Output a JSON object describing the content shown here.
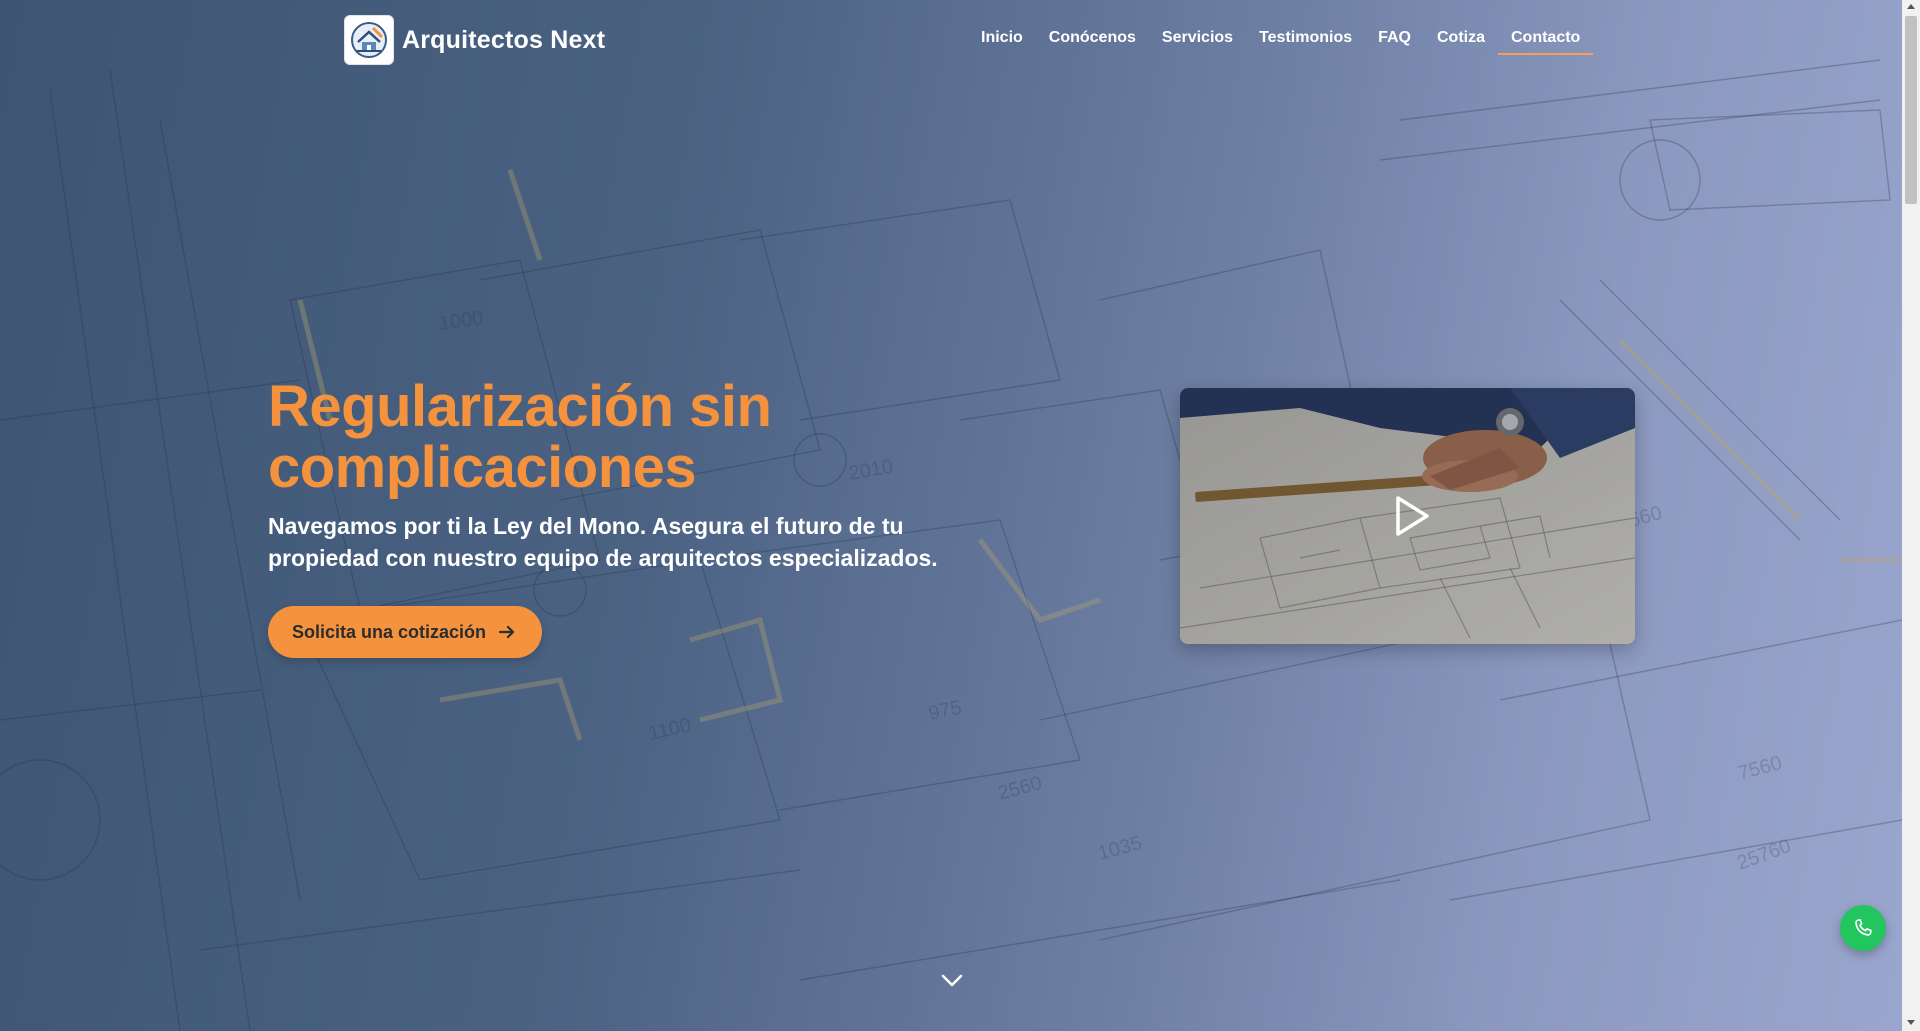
{
  "brand": {
    "name": "Arquitectos Next",
    "logo_icon": "architect-house-drawing-icon"
  },
  "nav": {
    "items": [
      {
        "label": "Inicio",
        "active": false
      },
      {
        "label": "Conócenos",
        "active": false
      },
      {
        "label": "Servicios",
        "active": false
      },
      {
        "label": "Testimonios",
        "active": false
      },
      {
        "label": "FAQ",
        "active": false
      },
      {
        "label": "Cotiza",
        "active": false
      },
      {
        "label": "Contacto",
        "active": true
      }
    ]
  },
  "hero": {
    "title": "Regularización sin complicaciones",
    "subtitle": "Navegamos por ti la Ley del Mono. Asegura el futuro de tu propiedad con nuestro equipo de arquitectos especializados.",
    "cta_label": "Solicita una cotización",
    "cta_icon": "arrow-right-icon"
  },
  "video": {
    "thumbnail": "hands-drawing-blueprint",
    "play_icon": "play-icon"
  },
  "floating": {
    "phone_icon": "phone-icon",
    "scroll_icon": "chevron-down-icon"
  },
  "colors": {
    "accent": "#f4923d",
    "nav_active_underline": "#f5a05a",
    "phone_button": "#22c55e",
    "overlay_start": "#3d5572",
    "overlay_end": "#9aa6cd"
  }
}
